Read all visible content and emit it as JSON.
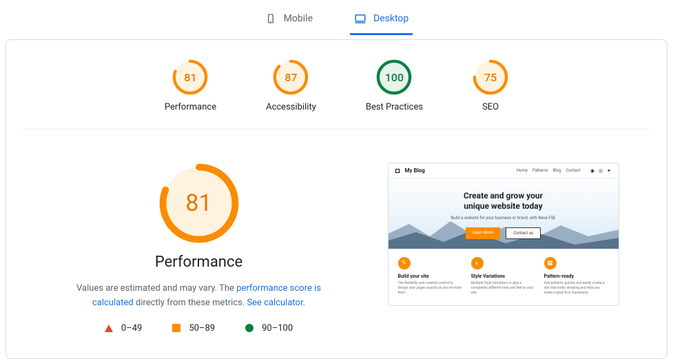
{
  "tabs": {
    "mobile": "Mobile",
    "desktop": "Desktop",
    "active": "desktop"
  },
  "gauges": [
    {
      "label": "Performance",
      "value": 81,
      "tier": "orange"
    },
    {
      "label": "Accessibility",
      "value": 87,
      "tier": "orange"
    },
    {
      "label": "Best Practices",
      "value": 100,
      "tier": "green"
    },
    {
      "label": "SEO",
      "value": 75,
      "tier": "orange"
    }
  ],
  "performance": {
    "value": 81,
    "title": "Performance",
    "desc_prefix": "Values are estimated and may vary. The ",
    "link1": "performance score is calculated",
    "desc_mid": " directly from these metrics. ",
    "link2": "See calculator."
  },
  "legend": {
    "bad": "0–49",
    "mid": "50–89",
    "good": "90–100"
  },
  "preview": {
    "brand": "My Blog",
    "nav": [
      "Home",
      "Patterns",
      "Blog",
      "Contact"
    ],
    "hero_title_l1": "Create and grow your",
    "hero_title_l2": "unique website today",
    "hero_sub": "Build a website for your business or brand, with Neve FSE",
    "cta_primary": "Learn More",
    "cta_secondary": "Contact us",
    "features": [
      {
        "title": "Build your site",
        "body": "The flexibility and creative control to design your pages exactly as you envision them"
      },
      {
        "title": "Style Variations",
        "body": "Multiple Style Variations to give a completely different look and feel to your site."
      },
      {
        "title": "Pattern-ready",
        "body": "Add patterns quickly and easily create a site that looks amazing and help you make a great first impression"
      }
    ]
  },
  "colors": {
    "orange": "#fb8c00",
    "green": "#0b8043",
    "red": "#ea4335",
    "blue": "#1a73e8"
  }
}
